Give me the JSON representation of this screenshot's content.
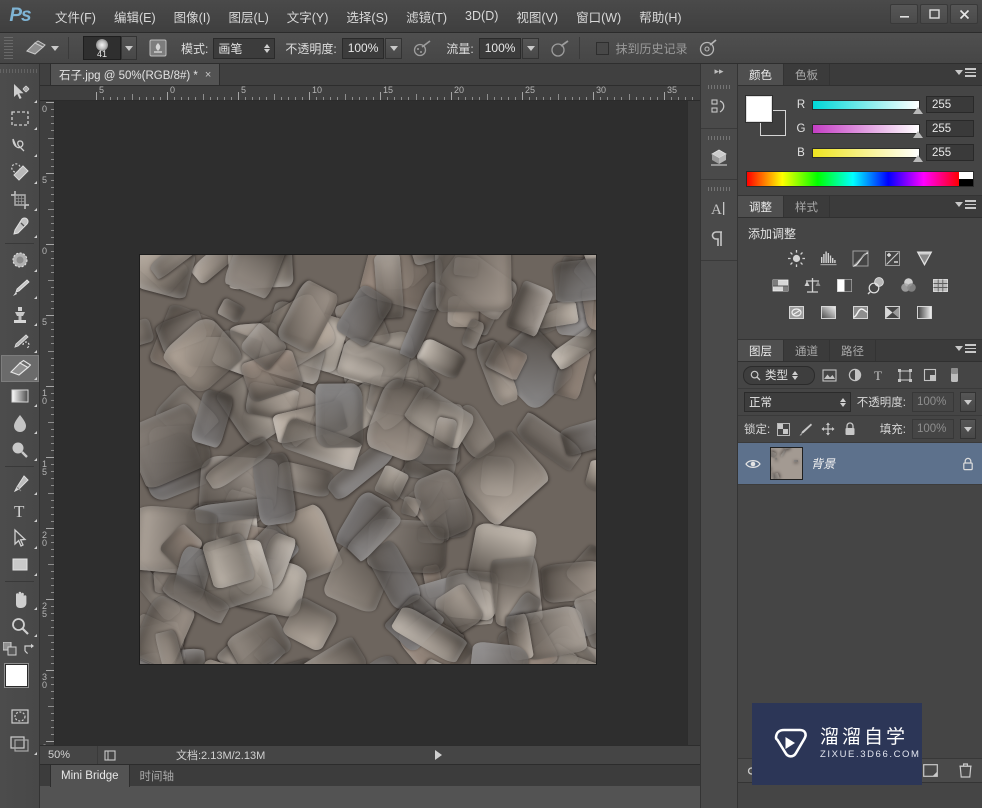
{
  "app": {
    "logo_text": "Ps",
    "menus": [
      {
        "label": "文件(F)",
        "name": "menu-file"
      },
      {
        "label": "编辑(E)",
        "name": "menu-edit"
      },
      {
        "label": "图像(I)",
        "name": "menu-image"
      },
      {
        "label": "图层(L)",
        "name": "menu-layer"
      },
      {
        "label": "文字(Y)",
        "name": "menu-type"
      },
      {
        "label": "选择(S)",
        "name": "menu-select"
      },
      {
        "label": "滤镜(T)",
        "name": "menu-filter"
      },
      {
        "label": "3D(D)",
        "name": "menu-3d"
      },
      {
        "label": "视图(V)",
        "name": "menu-view"
      },
      {
        "label": "窗口(W)",
        "name": "menu-window"
      },
      {
        "label": "帮助(H)",
        "name": "menu-help"
      }
    ],
    "window_controls": {
      "minimize": "—",
      "maximize": "❐",
      "close": "✕"
    }
  },
  "options_bar": {
    "tool_icon": "eraser-icon",
    "brush_size": "41",
    "mode_label": "模式:",
    "mode_value": "画笔",
    "opacity_label": "不透明度:",
    "opacity_value": "100%",
    "flow_label": "流量:",
    "flow_value": "100%",
    "erase_to_history_label": "抹到历史记录",
    "erase_to_history_checked": false
  },
  "toolbar": {
    "tools": [
      {
        "name": "move-tool",
        "label": "移动工具"
      },
      {
        "name": "marquee-tool",
        "label": "矩形选框工具"
      },
      {
        "name": "lasso-tool",
        "label": "套索工具"
      },
      {
        "name": "quick-selection-tool",
        "label": "快速选择工具"
      },
      {
        "name": "crop-tool",
        "label": "裁剪工具"
      },
      {
        "name": "eyedropper-tool",
        "label": "吸管工具"
      },
      {
        "name": "healing-brush-tool",
        "label": "污点修复画笔工具"
      },
      {
        "name": "brush-tool",
        "label": "画笔工具"
      },
      {
        "name": "clone-stamp-tool",
        "label": "仿制图章工具"
      },
      {
        "name": "history-brush-tool",
        "label": "历史记录画笔工具"
      },
      {
        "name": "eraser-tool",
        "label": "橡皮擦工具",
        "active": true
      },
      {
        "name": "gradient-tool",
        "label": "渐变工具"
      },
      {
        "name": "blur-tool",
        "label": "模糊工具"
      },
      {
        "name": "dodge-tool",
        "label": "减淡工具"
      },
      {
        "name": "pen-tool",
        "label": "钢笔工具"
      },
      {
        "name": "type-tool",
        "label": "横排文字工具"
      },
      {
        "name": "path-selection-tool",
        "label": "路径选择工具"
      },
      {
        "name": "rectangle-tool",
        "label": "矩形工具"
      },
      {
        "name": "hand-tool",
        "label": "抓手工具"
      },
      {
        "name": "zoom-tool",
        "label": "缩放工具"
      }
    ],
    "foreground_color": "#ffffff",
    "background_color": "#3b3b3b"
  },
  "document": {
    "tab_title": "石子.jpg @ 50%(RGB/8#) *",
    "close_glyph": "×",
    "ruler_h_labels": [
      "5",
      "0",
      "5",
      "10",
      "15",
      "20",
      "25",
      "30",
      "35"
    ],
    "ruler_v_labels": [
      "0",
      "5",
      "0",
      "5",
      "10",
      "15",
      "20",
      "25",
      "30",
      "35"
    ],
    "status_zoom": "50%",
    "status_doc": "文档:2.13M/2.13M",
    "bottom_tabs": [
      {
        "label": "Mini Bridge",
        "active": true
      },
      {
        "label": "时间轴",
        "active": false
      }
    ]
  },
  "icon_dock": {
    "icons": [
      {
        "name": "history-icon"
      },
      {
        "name": "3d-icon"
      },
      {
        "name": "character-icon"
      },
      {
        "name": "paragraph-icon"
      }
    ]
  },
  "color_panel": {
    "tabs": [
      {
        "label": "颜色",
        "active": true
      },
      {
        "label": "色板",
        "active": false
      }
    ],
    "channels": [
      {
        "label": "R",
        "value": "255"
      },
      {
        "label": "G",
        "value": "255"
      },
      {
        "label": "B",
        "value": "255"
      }
    ],
    "foreground": "#ffffff",
    "background": "#3e3e3e"
  },
  "adjustments_panel": {
    "tabs": [
      {
        "label": "调整",
        "active": true
      },
      {
        "label": "样式",
        "active": false
      }
    ],
    "title": "添加调整",
    "buttons": [
      [
        {
          "name": "brightness-contrast-icon"
        },
        {
          "name": "levels-icon"
        },
        {
          "name": "curves-icon"
        },
        {
          "name": "exposure-icon"
        },
        {
          "name": "vibrance-icon"
        }
      ],
      [
        {
          "name": "hue-saturation-icon"
        },
        {
          "name": "color-balance-icon"
        },
        {
          "name": "black-white-icon"
        },
        {
          "name": "photo-filter-icon"
        },
        {
          "name": "channel-mixer-icon"
        },
        {
          "name": "color-lookup-icon"
        }
      ],
      [
        {
          "name": "invert-icon"
        },
        {
          "name": "posterize-icon"
        },
        {
          "name": "threshold-icon"
        },
        {
          "name": "selective-color-icon"
        },
        {
          "name": "gradient-map-icon"
        }
      ]
    ]
  },
  "layers_panel": {
    "tabs": [
      {
        "label": "图层",
        "active": true
      },
      {
        "label": "通道",
        "active": false
      },
      {
        "label": "路径",
        "active": false
      }
    ],
    "filter_value": "类型",
    "filter_icons": [
      {
        "name": "filter-pixel-icon"
      },
      {
        "name": "filter-adjustment-icon"
      },
      {
        "name": "filter-type-icon"
      },
      {
        "name": "filter-shape-icon"
      },
      {
        "name": "filter-smart-object-icon"
      },
      {
        "name": "filter-toggle-icon"
      }
    ],
    "blend_mode": "正常",
    "opacity_label": "不透明度:",
    "opacity_value": "100%",
    "lock_label": "锁定:",
    "lock_icons": [
      {
        "name": "lock-transparency-icon"
      },
      {
        "name": "lock-image-icon"
      },
      {
        "name": "lock-position-icon"
      },
      {
        "name": "lock-all-icon"
      }
    ],
    "fill_label": "填充:",
    "fill_value": "100%",
    "layers": [
      {
        "name": "背景",
        "visible": true,
        "locked": true,
        "selected": true
      }
    ],
    "bottom_icons": [
      {
        "name": "link-layers-icon"
      },
      {
        "name": "layer-style-fx-icon"
      },
      {
        "name": "add-mask-icon"
      },
      {
        "name": "new-adjustment-layer-icon"
      },
      {
        "name": "new-group-icon"
      },
      {
        "name": "new-layer-icon"
      },
      {
        "name": "delete-layer-icon"
      }
    ]
  },
  "watermark": {
    "cn_text": "溜溜自学",
    "en_text": "ZIXUE.3D66.COM",
    "background": "#2c3657",
    "icon": "play-logo-icon"
  }
}
